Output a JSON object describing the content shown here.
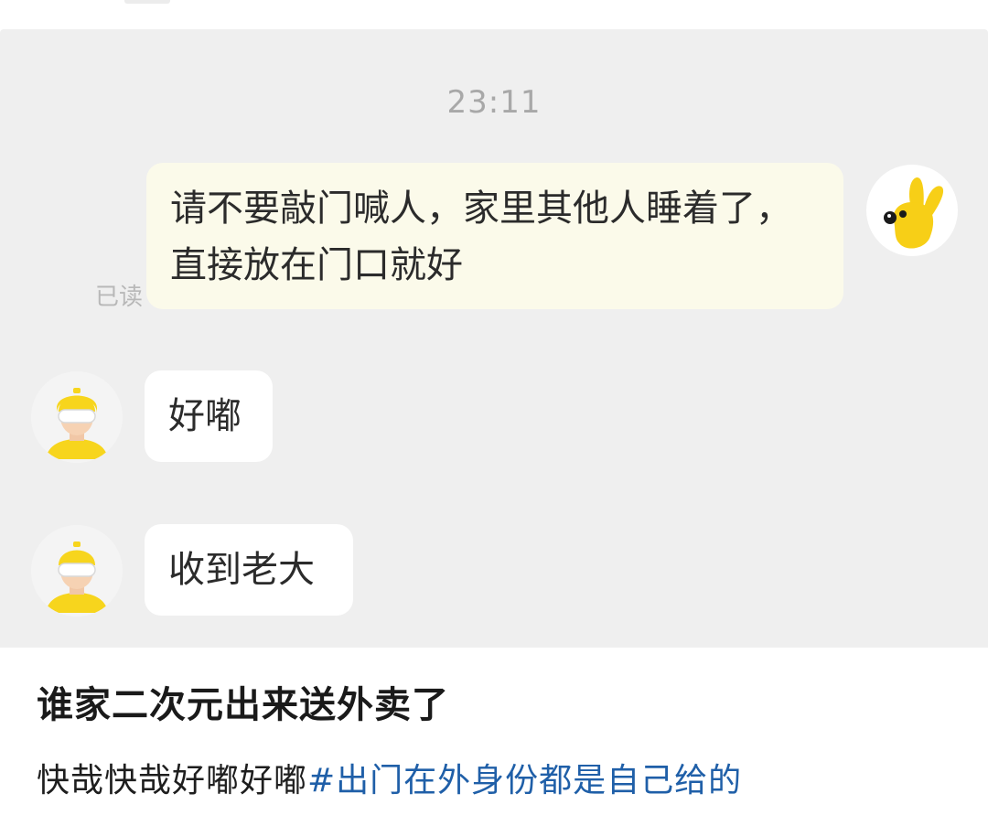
{
  "chat": {
    "timestamp": "23:11",
    "messages": [
      {
        "sender": "me",
        "text": "请不要敲门喊人，家里其他人睡着了，直接放在门口就好",
        "status": "已读"
      },
      {
        "sender": "rider",
        "text": "好嘟"
      },
      {
        "sender": "rider",
        "text": "收到老大"
      }
    ],
    "avatars": {
      "me": "yellow-bunny-avatar-icon",
      "rider": "delivery-rider-avatar-icon"
    }
  },
  "post": {
    "title": "谁家二次元出来送外卖了",
    "body_text": "快哉快哉好嘟好嘟",
    "hashtag": "#出门在外身份都是自己给的"
  },
  "colors": {
    "chat_background": "#efefef",
    "my_bubble": "#fbfaea",
    "rider_bubble": "#ffffff",
    "hashtag": "#1f5fa8",
    "rider_helmet": "#f7d51d"
  }
}
